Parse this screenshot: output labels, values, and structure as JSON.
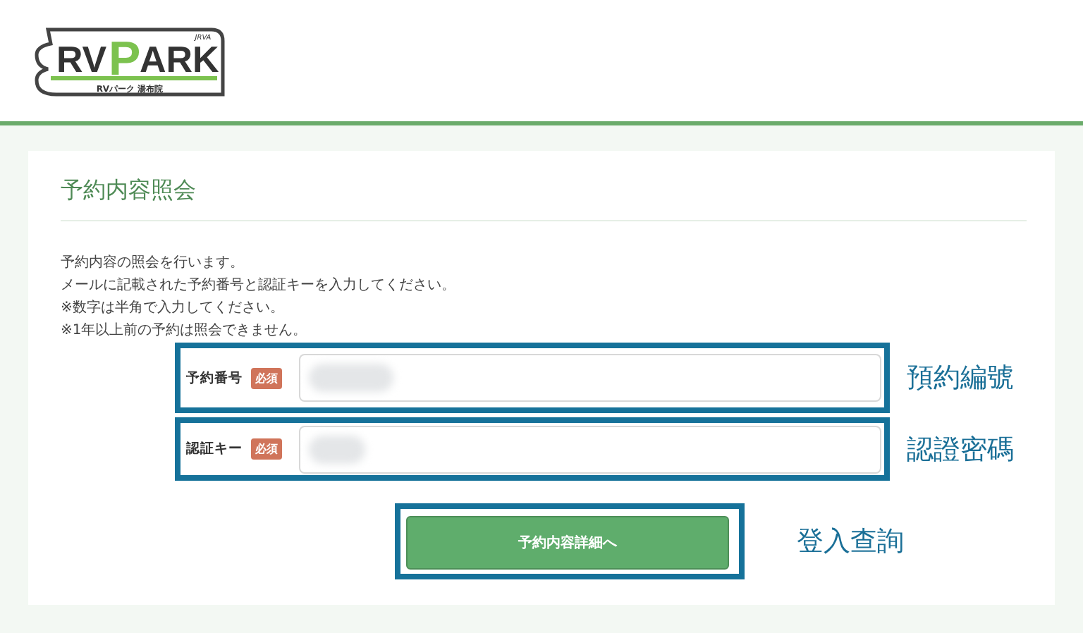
{
  "logo": {
    "badge": "JRVA",
    "rv": "RV",
    "p": "P",
    "ark": "ARK",
    "subtitle": "RVパーク 湯布院"
  },
  "page_title": "予約内容照会",
  "description": [
    "予約内容の照会を行います。",
    "メールに記載された予約番号と認証キーを入力してください。",
    "※数字は半角で入力してください。",
    "※1年以上前の予約は照会できません。"
  ],
  "fields": [
    {
      "label": "予約番号",
      "required_badge": "必須",
      "annotation": "預約編號"
    },
    {
      "label": "認証キー",
      "required_badge": "必須",
      "annotation": "認證密碼"
    }
  ],
  "submit": {
    "label": "予約内容詳細へ",
    "annotation": "登入查詢"
  }
}
